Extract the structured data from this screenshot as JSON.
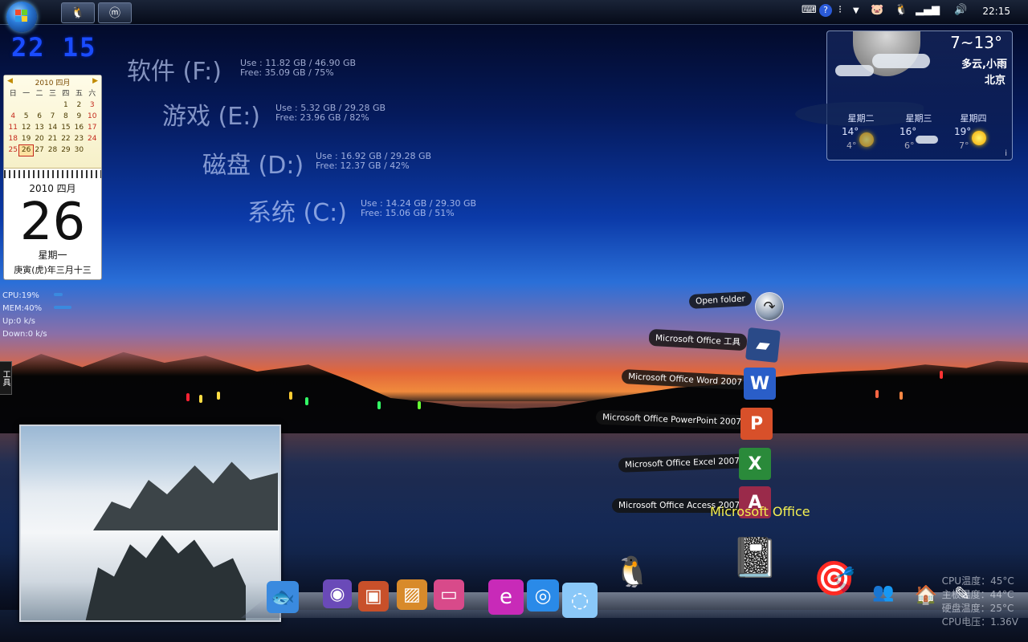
{
  "taskbar": {
    "clock": "22:15",
    "task_buttons": [
      {
        "name": "qq-task",
        "glyph": "🐧"
      },
      {
        "name": "maxthon-task",
        "glyph": "ⓜ"
      }
    ]
  },
  "digital_clock": "22 15",
  "calendar": {
    "header": "2010 四月",
    "weekdays": [
      "日",
      "一",
      "二",
      "三",
      "四",
      "五",
      "六"
    ],
    "days": [
      "",
      "",
      "",
      "",
      "1",
      "2",
      "3",
      "4",
      "5",
      "6",
      "7",
      "8",
      "9",
      "10",
      "11",
      "12",
      "13",
      "14",
      "15",
      "16",
      "17",
      "18",
      "19",
      "20",
      "21",
      "22",
      "23",
      "24",
      "25",
      "26",
      "27",
      "28",
      "29",
      "30"
    ],
    "today": "26",
    "month_line": "2010  四月",
    "day_big": "26",
    "weekday_line": "星期一",
    "lunar_line": "庚寅(虎)年三月十三"
  },
  "sysmon": {
    "cpu": "CPU:19%",
    "mem": "MEM:40%",
    "up": "Up:0 k/s",
    "down": "Down:0 k/s",
    "cpu_level": 0.19,
    "mem_level": 0.4
  },
  "side_tab": "工具",
  "drives": [
    {
      "name": "软件 (F:)",
      "use": "Use : 11.82 GB / 46.90 GB",
      "free": "Free: 35.09 GB / 75%"
    },
    {
      "name": "游戏 (E:)",
      "use": "Use : 5.32 GB / 29.28 GB",
      "free": "Free: 23.96 GB / 82%"
    },
    {
      "name": "磁盘 (D:)",
      "use": "Use : 16.92 GB / 29.28 GB",
      "free": "Free: 12.37 GB / 42%"
    },
    {
      "name": "系统 (C:)",
      "use": "Use : 14.24 GB / 29.30 GB",
      "free": "Free: 15.06 GB / 51%"
    }
  ],
  "weather": {
    "range": "7~13°",
    "desc": "多云,小雨",
    "city": "北京",
    "forecast": [
      {
        "day": "星期二",
        "hi": "14°",
        "lo": "4°"
      },
      {
        "day": "星期三",
        "hi": "16°",
        "lo": "6°"
      },
      {
        "day": "星期四",
        "hi": "19°",
        "lo": "7°"
      }
    ]
  },
  "stack_menu": {
    "open_folder": "Open folder",
    "items": [
      {
        "label": "Microsoft Office 工具",
        "icon": "folder-icon",
        "color": "#2a4a88"
      },
      {
        "label": "Microsoft Office Word 2007",
        "icon": "word-icon",
        "color": "#2a5ec8"
      },
      {
        "label": "Microsoft Office PowerPoint 2007",
        "icon": "powerpoint-icon",
        "color": "#d8502a"
      },
      {
        "label": "Microsoft Office Excel 2007",
        "icon": "excel-icon",
        "color": "#2a8a3a"
      },
      {
        "label": "Microsoft Office Access 2007",
        "icon": "access-icon",
        "color": "#9a2a4a"
      }
    ],
    "caption": "Microsoft Office"
  },
  "hardware": {
    "cpu_temp": "CPU温度：45°C",
    "board_temp": "主板温度：44°C",
    "hdd_temp": "硬盘温度：25°C",
    "cpu_volt": "CPU电压：1.36V"
  },
  "dock": [
    {
      "name": "fish-icon",
      "glyph": "🐟",
      "color": "#3a8adf"
    },
    {
      "name": "media-player-icon",
      "glyph": "◉",
      "color": "#6a4ab8"
    },
    {
      "name": "video-icon",
      "glyph": "▣",
      "color": "#c8502a"
    },
    {
      "name": "photo-viewer-icon",
      "glyph": "▨",
      "color": "#d88a2a"
    },
    {
      "name": "music-icon",
      "glyph": "▭",
      "color": "#d84a8a"
    },
    {
      "name": "email-icon",
      "glyph": "e",
      "color": "#c82ab8"
    },
    {
      "name": "browser-icon",
      "glyph": "◎",
      "color": "#2a8ae8"
    },
    {
      "name": "chat-icon",
      "glyph": "◌",
      "color": "#8ac8f8"
    },
    {
      "name": "qq-icon",
      "glyph": "🐧",
      "color": "transparent"
    },
    {
      "name": "notebook-icon",
      "glyph": "📓",
      "color": "transparent"
    },
    {
      "name": "finance-icon",
      "glyph": "🎯",
      "color": "transparent"
    },
    {
      "name": "contacts-icon",
      "glyph": "👥",
      "color": "transparent"
    },
    {
      "name": "home-icon",
      "glyph": "🏠",
      "color": "transparent"
    },
    {
      "name": "notes-icon",
      "glyph": "✎",
      "color": "transparent"
    }
  ]
}
